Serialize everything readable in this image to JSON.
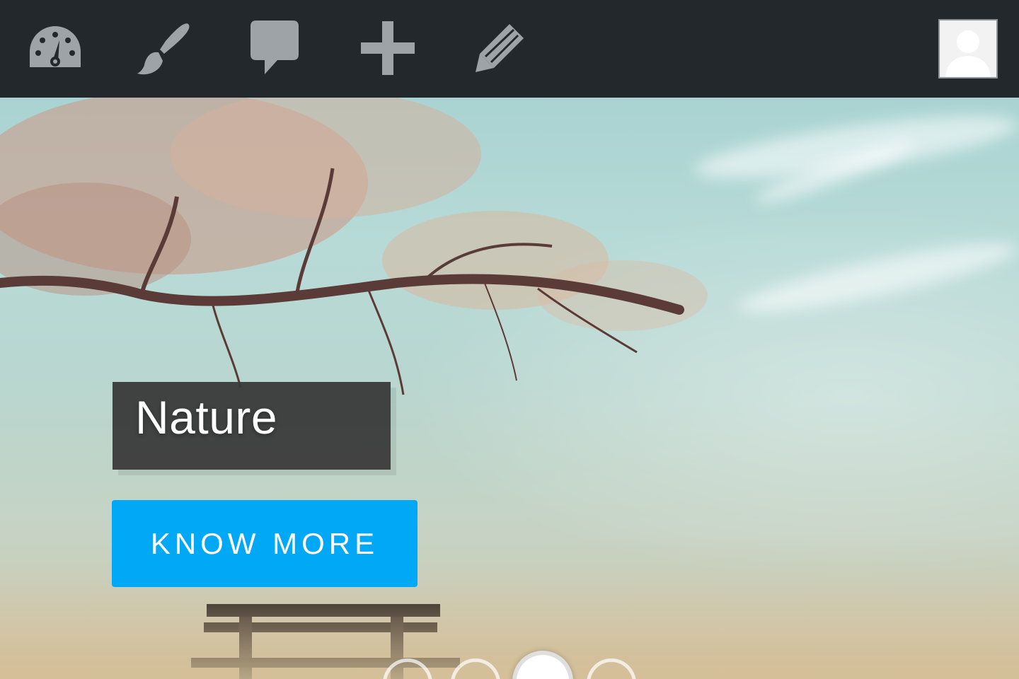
{
  "toolbar": {
    "icons": [
      {
        "name": "dashboard-icon"
      },
      {
        "name": "paintbrush-icon"
      },
      {
        "name": "comment-icon"
      },
      {
        "name": "plus-icon"
      },
      {
        "name": "pencil-icon"
      }
    ],
    "avatar": "user-avatar-placeholder"
  },
  "slide": {
    "title": "Nature",
    "cta_label": "KNOW MORE",
    "dots_total": 4,
    "active_dot": 3
  },
  "colors": {
    "toolbar_bg": "#23282d",
    "icon_gray": "#9ea3a8",
    "cta_blue": "#00a8f6",
    "title_box": "#373737"
  }
}
